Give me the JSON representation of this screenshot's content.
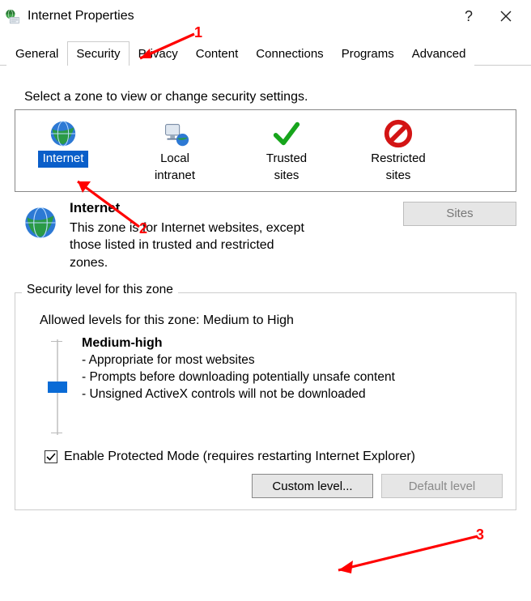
{
  "window": {
    "title": "Internet Properties"
  },
  "tabs": {
    "general": "General",
    "security": "Security",
    "privacy": "Privacy",
    "content": "Content",
    "connections": "Connections",
    "programs": "Programs",
    "advanced": "Advanced"
  },
  "instruction": "Select a zone to view or change security settings.",
  "zones": {
    "internet": "Internet",
    "intranet_line1": "Local",
    "intranet_line2": "intranet",
    "trusted_line1": "Trusted",
    "trusted_line2": "sites",
    "restricted_line1": "Restricted",
    "restricted_line2": "sites"
  },
  "selected_zone": {
    "name": "Internet",
    "desc": "This zone is for Internet websites, except those listed in trusted and restricted zones."
  },
  "buttons": {
    "sites": "Sites",
    "custom": "Custom level...",
    "default": "Default level"
  },
  "group": {
    "legend": "Security level for this zone",
    "allowed": "Allowed levels for this zone: Medium to High",
    "level_name": "Medium-high",
    "b1": "- Appropriate for most websites",
    "b2": "- Prompts before downloading potentially unsafe content",
    "b3": "- Unsigned ActiveX controls will not be downloaded",
    "checkbox": "Enable Protected Mode (requires restarting Internet Explorer)"
  },
  "annotations": {
    "n1": "1",
    "n2": "2",
    "n3": "3"
  }
}
